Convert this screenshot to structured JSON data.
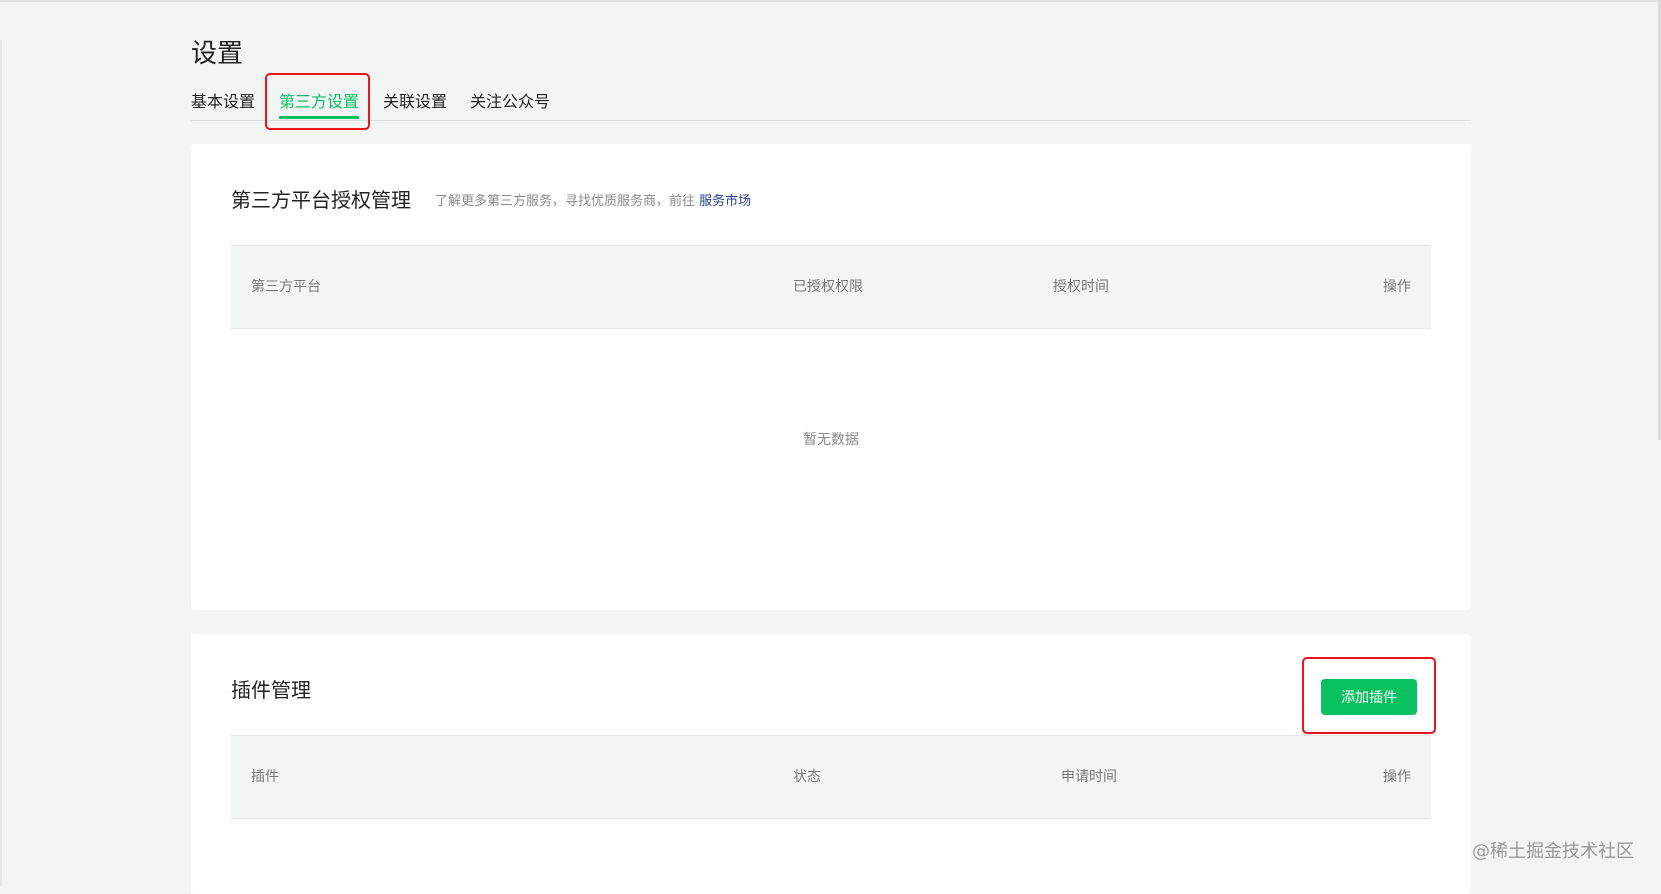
{
  "page": {
    "title": "设置"
  },
  "tabs": [
    {
      "label": "基本设置"
    },
    {
      "label": "第三方设置"
    },
    {
      "label": "关联设置"
    },
    {
      "label": "关注公众号"
    }
  ],
  "authorization": {
    "title": "第三方平台授权管理",
    "description": "了解更多第三方服务，寻找优质服务商，前往",
    "link_label": "服务市场",
    "columns": [
      "第三方平台",
      "已授权权限",
      "授权时间",
      "操作"
    ],
    "empty_text": "暂无数据"
  },
  "plugins": {
    "title": "插件管理",
    "add_button_label": "添加插件",
    "columns": [
      "插件",
      "状态",
      "申请时间",
      "操作"
    ]
  },
  "watermark": "@稀土掘金技术社区",
  "colors": {
    "accent": "#07c160",
    "highlight": "#e8161b",
    "link": "#1e3f9d",
    "background": "#f3f5f5"
  }
}
